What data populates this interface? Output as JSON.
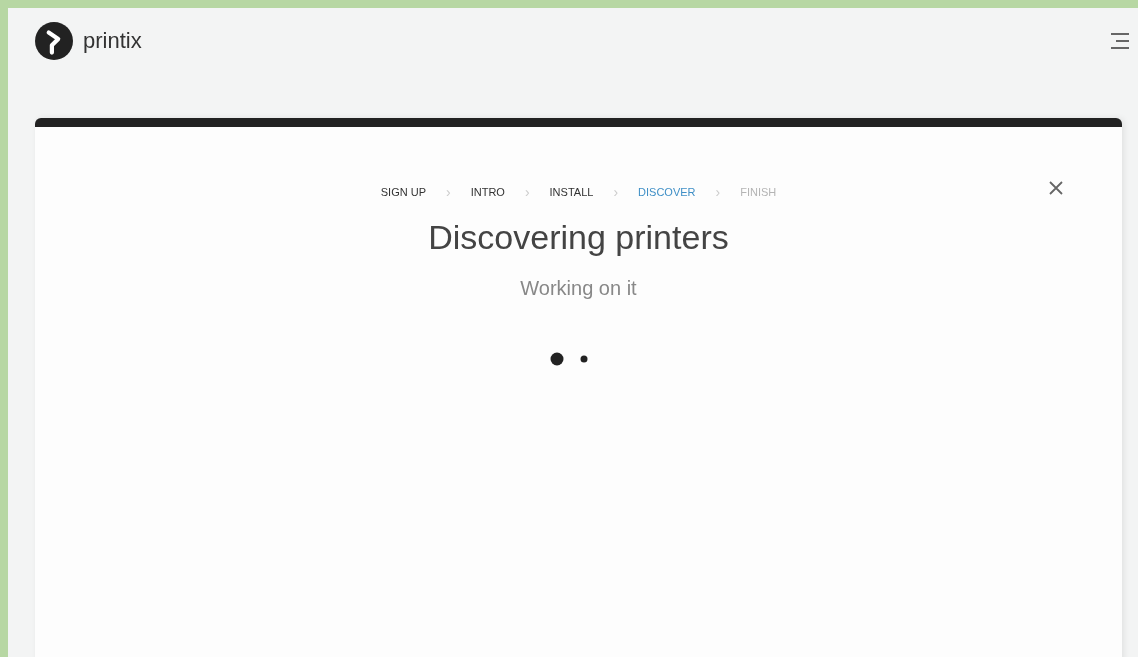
{
  "header": {
    "logo_text": "printix"
  },
  "wizard": {
    "steps": [
      {
        "label": "SIGN UP",
        "selected": false,
        "disabled": false
      },
      {
        "label": "INTRO",
        "selected": false,
        "disabled": false
      },
      {
        "label": "INSTALL",
        "selected": false,
        "disabled": false
      },
      {
        "label": "DISCOVER",
        "selected": true,
        "disabled": false
      },
      {
        "label": "FINISH",
        "selected": false,
        "disabled": true
      }
    ],
    "separator": "›",
    "title": "Discovering printers",
    "subtitle": "Working on it"
  }
}
